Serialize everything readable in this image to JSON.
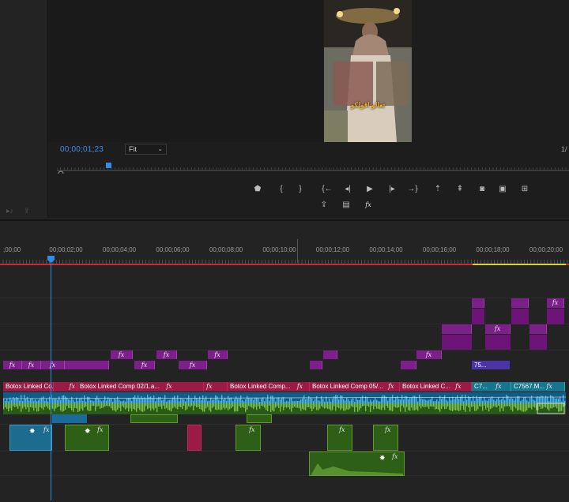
{
  "program_monitor": {
    "timecode": "00;00;01;23",
    "zoom_select": "Fit",
    "zoom_chevron": "⌄",
    "ratio": "1/",
    "caption": "تعالو اقولكو",
    "transport": [
      {
        "name": "add-marker",
        "glyph": "⬟"
      },
      {
        "name": "mark-in",
        "glyph": "{"
      },
      {
        "name": "mark-out",
        "glyph": "}"
      },
      {
        "name": "go-to-in",
        "glyph": "{←"
      },
      {
        "name": "step-back",
        "glyph": "◂|"
      },
      {
        "name": "play",
        "glyph": "▶"
      },
      {
        "name": "step-forward",
        "glyph": "|▸"
      },
      {
        "name": "go-to-out",
        "glyph": "→}"
      },
      {
        "name": "lift",
        "glyph": "⇡"
      },
      {
        "name": "extract",
        "glyph": "⇞"
      },
      {
        "name": "export-frame",
        "glyph": "◙"
      },
      {
        "name": "comparison-view",
        "glyph": "▣"
      },
      {
        "name": "button-editor",
        "glyph": "⊞"
      }
    ],
    "transport_row2": [
      {
        "name": "export",
        "glyph": "⇪"
      },
      {
        "name": "multicam",
        "glyph": "▤"
      },
      {
        "name": "fx",
        "glyph": "fx"
      }
    ]
  },
  "ruler": [
    "00;00",
    "00;00;02;00",
    "00;00;04;00",
    "00;00;06;00",
    "00;00;08;00",
    "00;00;10;00",
    "00;00;12;00",
    "00;00;14;00",
    "00;00;16;00",
    "00;00;18;00",
    "00;00;20;00"
  ],
  "ruler_display": [
    ";00;00",
    "00;00;02;00",
    "00;00;04;00",
    "00;00;06;00",
    "00;00;08;00",
    "00;00;10;00",
    "00;00;12;00",
    "00;00;14;00",
    "00;00;16;00",
    "00;00;18;00",
    "00;00;20;00"
  ],
  "clips": {
    "v_red": [
      {
        "label": "Botox Linked Co...",
        "fx": "fx"
      },
      {
        "label": "Botox Linked Comp 02/1.a...",
        "fx": "fx"
      },
      {
        "label": "Botox Linked Comp...",
        "fx": "fx"
      },
      {
        "label": "Botox Linked Comp 05/...",
        "fx": "fx"
      },
      {
        "label": "Botox Linked C...",
        "fx": "fx"
      }
    ],
    "v_teal": [
      {
        "label": "C7...",
        "fx": ""
      },
      {
        "label": "C7567.M...",
        "fx": ""
      }
    ],
    "purple_label": "75..."
  },
  "colors": {
    "accent_timecode": "#3d8ee6",
    "clip_red": "#9a1b45",
    "clip_teal": "#17758d",
    "clip_purple": "#7d1f8a",
    "clip_green": "#2e5f17",
    "playhead": "#2f8de4"
  }
}
